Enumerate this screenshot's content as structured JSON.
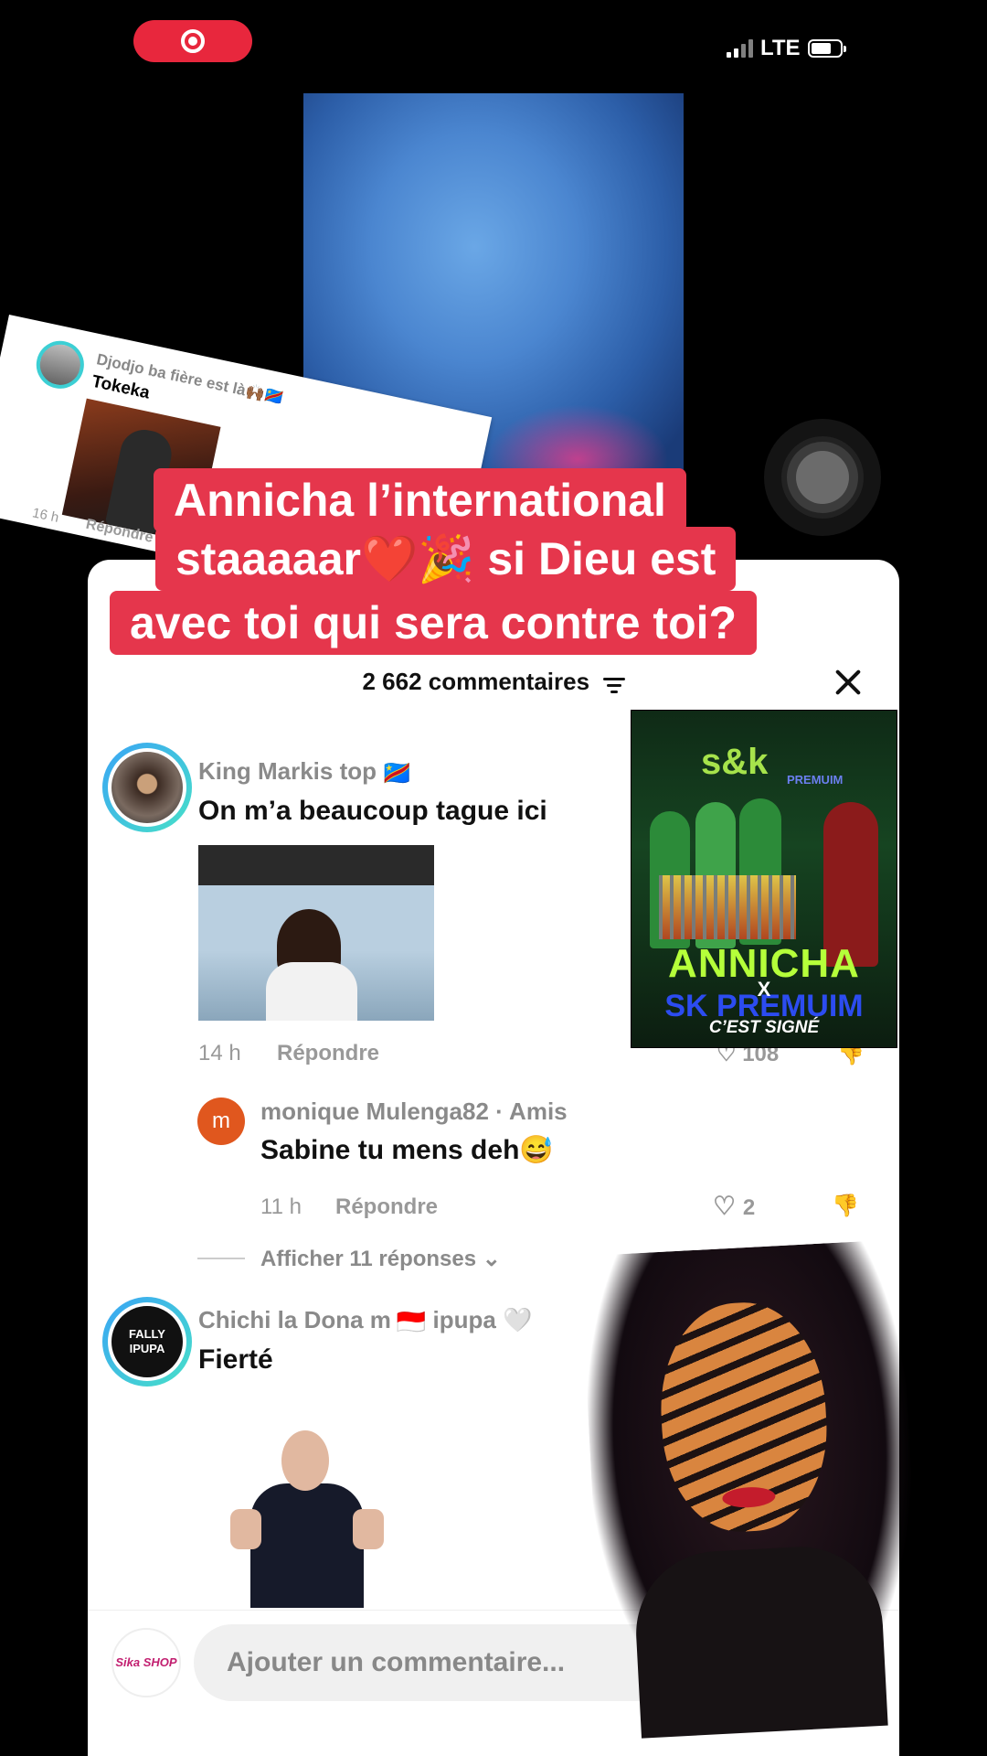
{
  "status_bar": {
    "network": "LTE"
  },
  "caption": {
    "lines": [
      "Annicha l’international",
      "staaaaar❤️🎉 si Dieu est",
      "avec toi qui sera contre toi?"
    ]
  },
  "tilted_card": {
    "user": "Djodjo ba fière est là🙌🏾🇨🇩",
    "text": "Tokeka",
    "time": "16 h",
    "reply": "Répondre"
  },
  "comments_panel": {
    "count_label": "2 662 commentaires",
    "comments": [
      {
        "user": "King Markis top",
        "flag": "🇨🇩",
        "text": "On m’a beaucoup tague ici",
        "time": "14 h",
        "reply_label": "Répondre",
        "likes": "108"
      },
      {
        "user": "monique Mulenga82 · Amis",
        "avatar_letter": "m",
        "text": "Sabine tu mens deh😅",
        "time": "11 h",
        "reply_label": "Répondre",
        "likes": "2"
      },
      {
        "show_replies": "Afficher 11 réponses"
      },
      {
        "user": "Chichi la Dona m",
        "flag": "🇮🇩",
        "user_suffix": "ipupa 🤍",
        "avatar_text": "FALLY IPUPA",
        "text": "Fierté"
      }
    ],
    "composer_placeholder": "Ajouter un commentaire...",
    "composer_avatar_text": "Sika SHOP"
  },
  "ad_poster": {
    "logo": "s&k",
    "logo_sub": "PREMUIM",
    "title": "ANNICHA",
    "x": "X",
    "brand": "SK PREMUIM",
    "tagline": "C’EST SIGNÉ"
  },
  "colors": {
    "accent_red": "#e5364c",
    "ring_gradient_start": "#3aa4f5",
    "ring_gradient_end": "#47e0c8"
  }
}
